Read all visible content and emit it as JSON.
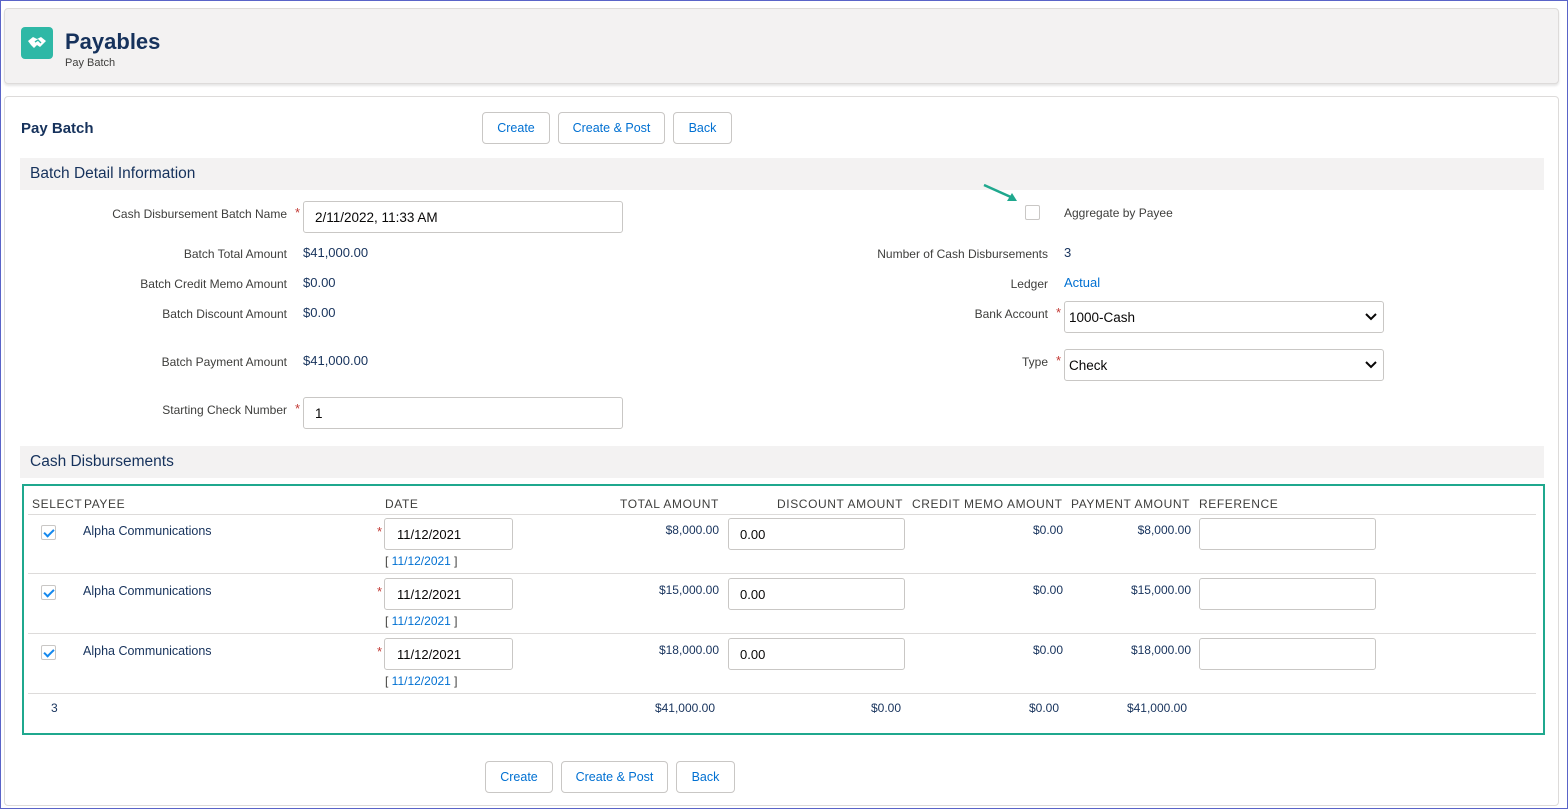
{
  "header": {
    "title": "Payables",
    "subtitle": "Pay Batch",
    "icon": "handshake-icon",
    "icon_color": "#2eb8a6"
  },
  "card": {
    "title": "Pay Batch"
  },
  "buttons": {
    "create": "Create",
    "create_post": "Create & Post",
    "back": "Back"
  },
  "batch_detail": {
    "section_title": "Batch Detail Information",
    "batch_name_label": "Cash Disbursement Batch Name",
    "batch_name_value": "2/11/2022, 11:33 AM",
    "total_amount_label": "Batch Total Amount",
    "total_amount_value": "$41,000.00",
    "credit_memo_label": "Batch Credit Memo Amount",
    "credit_memo_value": "$0.00",
    "discount_label": "Batch Discount Amount",
    "discount_value": "$0.00",
    "payment_label": "Batch Payment Amount",
    "payment_value": "$41,000.00",
    "check_number_label": "Starting Check Number",
    "check_number_value": "1",
    "aggregate_label": "Aggregate by Payee",
    "aggregate_checked": false,
    "num_disbursements_label": "Number of Cash Disbursements",
    "num_disbursements_value": "3",
    "ledger_label": "Ledger",
    "ledger_value": "Actual",
    "bank_account_label": "Bank Account",
    "bank_account_value": "1000-Cash",
    "type_label": "Type",
    "type_value": "Check"
  },
  "disbursements": {
    "section_title": "Cash Disbursements",
    "columns": {
      "select": "SELECT",
      "payee": "PAYEE",
      "date": "DATE",
      "total": "TOTAL AMOUNT",
      "discount": "DISCOUNT AMOUNT",
      "credit": "CREDIT MEMO AMOUNT",
      "payment": "PAYMENT AMOUNT",
      "reference": "REFERENCE"
    },
    "rows": [
      {
        "checked": true,
        "payee": "Alpha Communications",
        "date": "11/12/2021",
        "date_link": "11/12/2021",
        "total": "$8,000.00",
        "discount": "0.00",
        "credit": "$0.00",
        "payment": "$8,000.00",
        "reference": ""
      },
      {
        "checked": true,
        "payee": "Alpha Communications",
        "date": "11/12/2021",
        "date_link": "11/12/2021",
        "total": "$15,000.00",
        "discount": "0.00",
        "credit": "$0.00",
        "payment": "$15,000.00",
        "reference": ""
      },
      {
        "checked": true,
        "payee": "Alpha Communications",
        "date": "11/12/2021",
        "date_link": "11/12/2021",
        "total": "$18,000.00",
        "discount": "0.00",
        "credit": "$0.00",
        "payment": "$18,000.00",
        "reference": ""
      }
    ],
    "totals": {
      "count": "3",
      "total": "$41,000.00",
      "discount": "$0.00",
      "credit": "$0.00",
      "payment": "$41,000.00"
    }
  },
  "annotation": {
    "arrow_color": "#1fa88e",
    "table_highlight_color": "#1fa88e"
  }
}
